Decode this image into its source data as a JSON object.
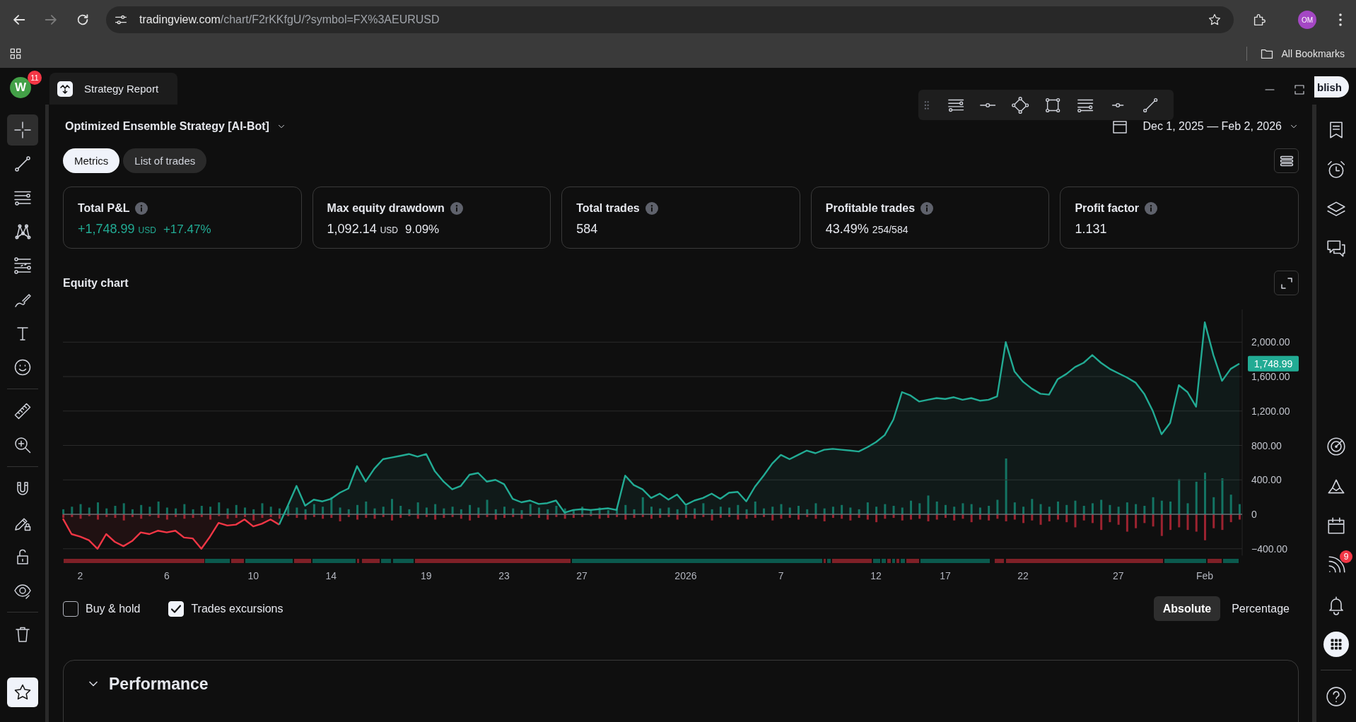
{
  "browser": {
    "back_button": {
      "disabled": false
    },
    "forward_button": {
      "disabled": true
    },
    "address_bar": {
      "host": "tradingview.com",
      "path": "/chart/F2rKKfgU/?symbol=FX%3AEURUSD"
    },
    "profile": {
      "initials": "OM"
    },
    "bookmarks_bar": {
      "items": [
        {
          "label": "All Bookmarks"
        }
      ]
    }
  },
  "header": {
    "account": {
      "initial": "W",
      "badge": "11"
    },
    "tabs": [
      {
        "label": "Strategy Report",
        "selected": true
      }
    ],
    "publish_button": {
      "label": "blish"
    }
  },
  "left_toolbar": {
    "tools": [
      {
        "selected": true
      },
      {
        "selected": false
      },
      {
        "selected": false
      },
      {
        "selected": false
      },
      {
        "selected": false
      },
      {
        "selected": false
      },
      {
        "selected": false
      },
      {
        "selected": false
      },
      {
        "selected": false
      },
      {
        "selected": false
      },
      {
        "selected": false
      },
      {
        "selected": false
      },
      {
        "selected": false
      },
      {
        "selected": false
      },
      {
        "selected": false
      }
    ],
    "favorites_button": {
      "selected": true
    }
  },
  "right_toolbar": {
    "notification_badge": "9"
  },
  "strategy_report": {
    "strategy": "Optimized Ensemble Strategy [AI-Bot]",
    "date_range": "Dec 1, 2025 — Feb 2, 2026",
    "tabs": [
      {
        "label": "Metrics",
        "selected": true
      },
      {
        "label": "List of trades",
        "selected": false
      }
    ],
    "metrics": [
      {
        "title": "Total P&L",
        "positive": true,
        "value": [
          {
            "text": "+1,748.99",
            "kind": "main"
          },
          {
            "text": "USD",
            "kind": "unit"
          },
          {
            "text": "+17.47%",
            "kind": "secondary"
          }
        ]
      },
      {
        "title": "Max equity drawdown",
        "positive": false,
        "value": [
          {
            "text": "1,092.14",
            "kind": "main"
          },
          {
            "text": "USD",
            "kind": "unit"
          },
          {
            "text": "9.09%",
            "kind": "secondary"
          }
        ]
      },
      {
        "title": "Total trades",
        "positive": false,
        "value": [
          {
            "text": "584",
            "kind": "main"
          }
        ]
      },
      {
        "title": "Profitable trades",
        "positive": false,
        "value": [
          {
            "text": "43.49%",
            "kind": "main"
          },
          {
            "text": "254/584",
            "kind": "detail"
          }
        ]
      },
      {
        "title": "Profit factor",
        "positive": false,
        "value": [
          {
            "text": "1.131",
            "kind": "main"
          }
        ]
      }
    ],
    "equity_chart": {
      "title": "Equity chart",
      "last_value_label": "1,748.99",
      "chart_data": {
        "type": "area",
        "grid": true,
        "categories": [
          null,
          null,
          "2",
          null,
          null,
          null,
          null,
          null,
          null,
          null,
          null,
          null,
          "6",
          null,
          null,
          null,
          null,
          null,
          null,
          null,
          null,
          null,
          "10",
          null,
          null,
          null,
          null,
          null,
          null,
          null,
          null,
          "14",
          null,
          null,
          null,
          null,
          null,
          null,
          null,
          null,
          null,
          null,
          "19",
          null,
          null,
          null,
          null,
          null,
          null,
          null,
          null,
          "23",
          null,
          null,
          null,
          null,
          null,
          null,
          null,
          null,
          "27",
          null,
          null,
          null,
          null,
          null,
          null,
          null,
          null,
          null,
          null,
          null,
          "2026",
          null,
          null,
          null,
          null,
          null,
          null,
          null,
          null,
          null,
          null,
          "7",
          null,
          null,
          null,
          null,
          null,
          null,
          null,
          null,
          null,
          null,
          "12",
          null,
          null,
          null,
          null,
          null,
          null,
          null,
          "17",
          null,
          null,
          null,
          null,
          null,
          null,
          null,
          null,
          "22",
          null,
          null,
          null,
          null,
          null,
          null,
          null,
          null,
          null,
          null,
          "27",
          null,
          null,
          null,
          null,
          null,
          null,
          null,
          null,
          null,
          "Feb",
          null,
          null,
          null,
          null
        ],
        "ylim": [
          -480,
          2380
        ],
        "yticks": [
          {
            "value": 2000,
            "label": "2,000.00"
          },
          {
            "value": 1600,
            "label": "1,600.00"
          },
          {
            "value": 1200,
            "label": "1,200.00"
          },
          {
            "value": 800,
            "label": "800.00"
          },
          {
            "value": 400,
            "label": "400.00"
          },
          {
            "value": 0,
            "label": "0"
          },
          {
            "value": -400,
            "label": "−400.00"
          }
        ],
        "series": [
          {
            "color": "#f23645",
            "values": [
              -50,
              -230,
              -260,
              -300,
              -400,
              -230,
              -320,
              -370,
              -310,
              -210,
              -230,
              -190,
              -210,
              -190,
              -270,
              -280,
              -400,
              -260,
              -100,
              -130,
              -120,
              -60,
              -140,
              -110,
              -60,
              -120,
              null,
              null,
              null,
              null,
              null,
              null,
              null,
              null,
              null,
              null,
              null,
              null,
              null,
              null,
              null,
              null,
              null,
              null,
              null,
              null,
              null,
              null,
              null,
              null,
              null,
              null,
              null,
              null,
              null,
              null,
              null,
              null,
              null,
              null,
              null,
              null,
              null,
              null,
              null,
              null,
              null,
              null,
              null,
              null,
              null,
              null,
              null,
              null,
              null,
              null,
              null,
              null,
              null,
              null,
              null,
              null,
              null,
              null,
              null,
              null,
              null,
              null,
              null,
              null,
              null,
              null,
              null,
              null,
              null,
              null,
              null,
              null,
              null,
              null,
              null,
              null,
              null,
              null,
              null,
              null,
              null,
              null,
              null,
              null,
              null,
              null,
              null,
              null,
              null,
              null,
              null,
              null,
              null,
              null,
              null,
              null,
              null,
              null,
              null,
              null,
              null,
              null,
              null,
              null,
              null,
              null,
              null,
              null,
              null,
              null,
              null
            ]
          },
          {
            "color": "#22ab94",
            "values": [
              null,
              null,
              null,
              null,
              null,
              null,
              null,
              null,
              null,
              null,
              null,
              null,
              null,
              null,
              null,
              null,
              null,
              null,
              null,
              null,
              null,
              null,
              null,
              null,
              null,
              -120,
              100,
              330,
              100,
              170,
              150,
              180,
              250,
              300,
              560,
              380,
              530,
              640,
              660,
              680,
              700,
              670,
              700,
              500,
              380,
              290,
              330,
              460,
              480,
              380,
              400,
              350,
              180,
              140,
              160,
              120,
              130,
              160,
              20,
              50,
              60,
              50,
              60,
              70,
              50,
              450,
              340,
              290,
              190,
              240,
              170,
              230,
              110,
              160,
              190,
              240,
              180,
              250,
              260,
              150,
              320,
              450,
              590,
              690,
              640,
              690,
              740,
              710,
              750,
              760,
              750,
              740,
              730,
              780,
              840,
              920,
              1100,
              1420,
              1380,
              1310,
              1330,
              1350,
              1340,
              1360,
              1330,
              1350,
              1320,
              1330,
              1370,
              2000,
              1660,
              1540,
              1460,
              1400,
              1390,
              1570,
              1630,
              1710,
              1760,
              1850,
              1760,
              1690,
              1640,
              1590,
              1530,
              1400,
              1200,
              930,
              1060,
              1500,
              1420,
              1250,
              2230,
              1850,
              1550,
              1690,
              1750
            ]
          }
        ]
      }
    },
    "options": [
      {
        "label": "Buy & hold",
        "checked": false
      },
      {
        "label": "Trades excursions",
        "checked": true
      }
    ],
    "scale": [
      {
        "label": "Absolute",
        "selected": true
      },
      {
        "label": "Percentage",
        "selected": false
      }
    ],
    "sections": [
      {
        "title": "Performance",
        "expanded": true
      }
    ]
  }
}
